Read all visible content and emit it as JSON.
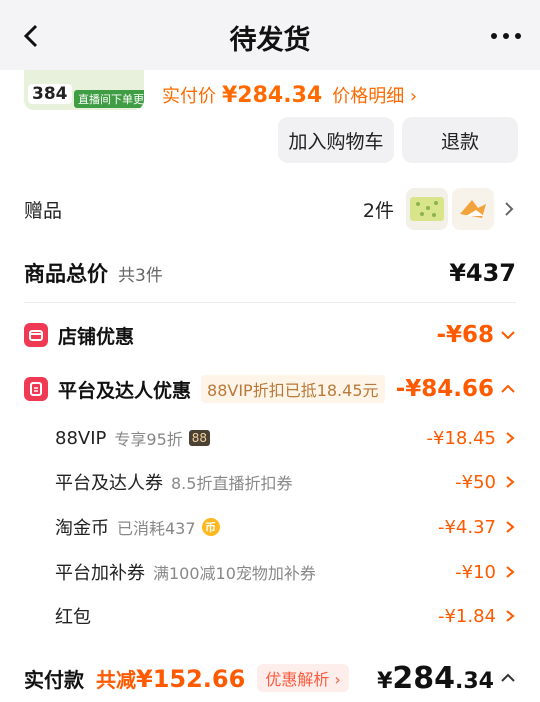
{
  "header": {
    "title": "待发货"
  },
  "product": {
    "thumb_price": "384",
    "thumb_banner": "直播间下单更优惠",
    "real_price_label": "实付价",
    "real_price_value": "¥284.34",
    "price_detail_label": "价格明细 ›"
  },
  "actions": {
    "cart_label": "加入购物车",
    "refund_label": "退款"
  },
  "gift": {
    "label": "赠品",
    "count": "2件"
  },
  "total": {
    "label": "商品总价",
    "count": "共3件",
    "value": "¥437"
  },
  "shop_promo": {
    "label": "店铺优惠",
    "value": "-¥68"
  },
  "platform_promo": {
    "label": "平台及达人优惠",
    "badge": "88VIP折扣已抵18.45元",
    "value": "-¥84.66"
  },
  "sub_items": [
    {
      "label": "88VIP",
      "desc": "专享95折",
      "tag": "88",
      "value": "-¥18.45"
    },
    {
      "label": "平台及达人券",
      "desc": "8.5折直播折扣券",
      "value": "-¥50"
    },
    {
      "label": "淘金币",
      "desc": "已消耗437",
      "coin": "币",
      "value": "-¥4.37"
    },
    {
      "label": "平台加补券",
      "desc": "满100减10宠物加补券",
      "value": "-¥10"
    },
    {
      "label": "红包",
      "desc": "",
      "value": "-¥1.84"
    }
  ],
  "payment": {
    "label": "实付款",
    "saved_prefix": "共减",
    "saved_amount": "¥152.66",
    "analysis_label": "优惠解析 ›",
    "currency": "¥",
    "value_int": "284",
    "value_dec": ".34"
  },
  "colors": {
    "accent": "#ff5a00",
    "promo_icon": "#f03a53",
    "header_bg": "#f4f4f6"
  },
  "icons": {
    "back": "chevron-left-icon",
    "more": "more-dots-icon",
    "chevron": "chevron-right-icon",
    "collapse": "chevron-up-icon",
    "expand": "chevron-down-icon",
    "shop": "shop-icon",
    "platform": "coupon-icon"
  }
}
